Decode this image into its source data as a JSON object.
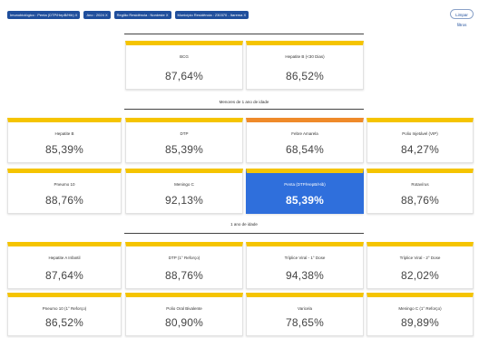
{
  "filters": [
    "Imunobiológico : Penta (DTP/HepB/Hib)  X",
    "Ano : 2024  X",
    "Região Residência : Nordeste  X",
    "Município Residência : 230370 - Itarema  X"
  ],
  "clear_button": "Limpar filtros",
  "top_cards": [
    {
      "name": "BCG",
      "value": "87,64%"
    },
    {
      "name": "Hepatite B (<30 Dias)",
      "value": "86,52%"
    }
  ],
  "section_under1": {
    "title": "Menores de 1 ano de idade",
    "cards": [
      {
        "name": "Hepatite B",
        "value": "85,39%"
      },
      {
        "name": "DTP",
        "value": "85,39%"
      },
      {
        "name": "Febre Amarela",
        "value": "68,54%"
      },
      {
        "name": "Polio Injetável (VIP)",
        "value": "84,27%"
      },
      {
        "name": "Pneumo 10",
        "value": "88,76%"
      },
      {
        "name": "Meningo C",
        "value": "92,13%"
      },
      {
        "name": "Penta (DTP/HepB/Hib)",
        "value": "85,39%"
      },
      {
        "name": "Rotavírus",
        "value": "88,76%"
      }
    ]
  },
  "section_1yr": {
    "title": "1 ano de idade",
    "cards": [
      {
        "name": "Hepatite A Infantil",
        "value": "87,64%"
      },
      {
        "name": "DTP (1° Reforço)",
        "value": "88,76%"
      },
      {
        "name": "Tríplice Viral - 1° Dose",
        "value": "94,38%"
      },
      {
        "name": "Tríplice Viral - 2° Dose",
        "value": "82,02%"
      },
      {
        "name": "Pneumo 10 (1° Reforço)",
        "value": "86,52%"
      },
      {
        "name": "Polio Oral Bivalente",
        "value": "80,90%"
      },
      {
        "name": "Varicela",
        "value": "78,65%"
      },
      {
        "name": "Meningo C (1° Reforço)",
        "value": "89,89%"
      }
    ]
  },
  "colors": {
    "accent_yellow": "#f5c400",
    "accent_orange": "#ef8a2a",
    "selected_blue": "#2f6fdc",
    "chip_blue": "#1f4e9c"
  }
}
